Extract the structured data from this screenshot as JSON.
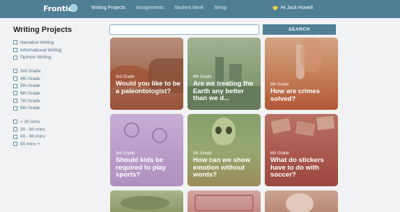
{
  "nav": {
    "logo": "Frontier",
    "items": [
      "Writing Projects",
      "Assignments",
      "Student Work",
      "Setup"
    ],
    "user": "Hi Jack Howell"
  },
  "colors": {
    "brand": "#4f7f95",
    "link": "#4b6f86",
    "heart": "#f2c94c"
  },
  "sidebar": {
    "title": "Writing Projects",
    "types": [
      "Narrative Writing",
      "Informational Writing",
      "Opinion Writing"
    ],
    "grades": [
      "3rd Grade",
      "4th Grade",
      "5th Grade",
      "6th Grade",
      "7th Grade",
      "8th Grade"
    ],
    "times": [
      "< 30 mins",
      "30 - 60 mins",
      "60 - 90 mins",
      "90 mins +"
    ]
  },
  "search": {
    "placeholder": "",
    "button": "SEARCH"
  },
  "cards": [
    {
      "grade": "3rd Grade",
      "title": "Would you like to be a paleontologist?"
    },
    {
      "grade": "8th Grade",
      "title": "Are we treating the Earth any better than we d..."
    },
    {
      "grade": "8th Grade",
      "title": "How are crimes solved?"
    },
    {
      "grade": "3rd Grade",
      "title": "Should kids be required to play sports?"
    },
    {
      "grade": "5th Grade",
      "title": "How can we show emotion without words?"
    },
    {
      "grade": "6th Grade",
      "title": "What do stickers have to do with soccer?"
    }
  ]
}
